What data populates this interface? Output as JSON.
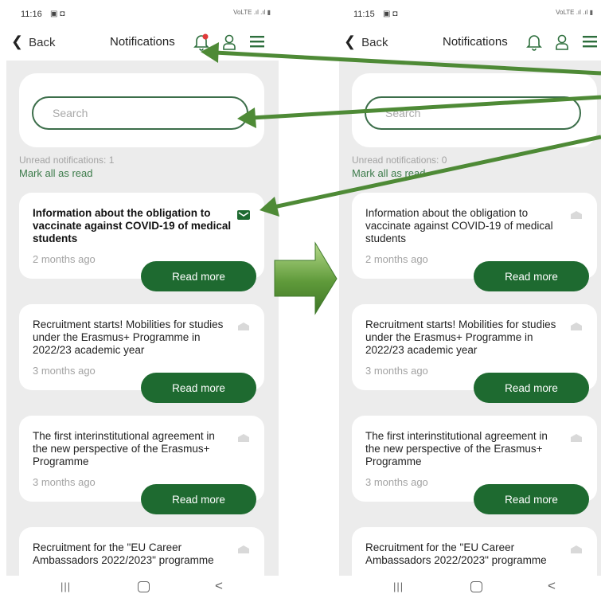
{
  "screens": [
    {
      "status": {
        "time": "11:16",
        "icons": "▣ ◘",
        "right_icons": "VoLTE .ıl .ıl ▮"
      },
      "header": {
        "back": "Back",
        "title": "Notifications",
        "has_new": true
      },
      "search": {
        "placeholder": "Search"
      },
      "unread_label": "Unread notifications: 1",
      "mark_all": "Mark all as read",
      "notifications": [
        {
          "title": "Information about the obligation to vaccinate against COVID-19 of medical students",
          "date": "2 months ago",
          "action": "Read more",
          "unread": true
        },
        {
          "title": "Recruitment starts! Mobilities for studies under the Erasmus+ Programme in 2022/23 academic year",
          "date": "3 months ago",
          "action": "Read more",
          "unread": false
        },
        {
          "title": "The first interinstitutional agreement in the new perspective of the Erasmus+ Programme",
          "date": "3 months ago",
          "action": "Read more",
          "unread": false
        },
        {
          "title": "Recruitment for the \"EU Career Ambassadors 2022/2023\" programme",
          "date": "",
          "action": "",
          "unread": false
        }
      ],
      "nav": {
        "recents": "|||",
        "back": "<"
      }
    },
    {
      "status": {
        "time": "11:15",
        "icons": "▣ ◘",
        "right_icons": "VoLTE .ıl .ıl ▮"
      },
      "header": {
        "back": "Back",
        "title": "Notifications",
        "has_new": false
      },
      "search": {
        "placeholder": "Search"
      },
      "unread_label": "Unread notifications: 0",
      "mark_all": "Mark all as read",
      "notifications": [
        {
          "title": "Information about the obligation to vaccinate against COVID-19 of medical students",
          "date": "2 months ago",
          "action": "Read more",
          "unread": false
        },
        {
          "title": "Recruitment starts! Mobilities for studies under the Erasmus+ Programme in 2022/23 academic year",
          "date": "3 months ago",
          "action": "Read more",
          "unread": false
        },
        {
          "title": "The first interinstitutional agreement in the new perspective of the Erasmus+ Programme",
          "date": "3 months ago",
          "action": "Read more",
          "unread": false
        },
        {
          "title": "Recruitment for the \"EU Career Ambassadors 2022/2023\" programme",
          "date": "",
          "action": "",
          "unread": false
        }
      ],
      "nav": {
        "recents": "|||",
        "back": "<"
      }
    }
  ],
  "colors": {
    "accent": "#1e6a30",
    "callout_arrow": "#4e8a36",
    "background": "#ececec"
  }
}
